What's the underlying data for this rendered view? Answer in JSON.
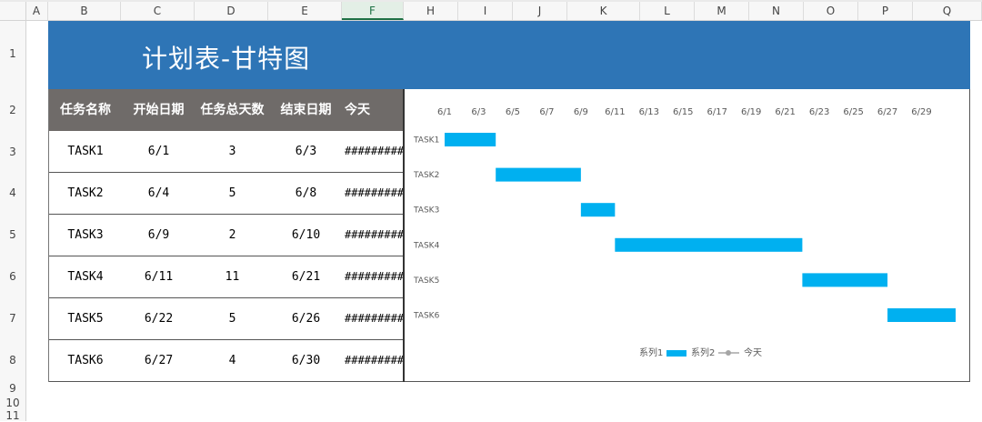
{
  "sheet": {
    "columns": [
      "A",
      "B",
      "C",
      "D",
      "E",
      "F",
      "H",
      "I",
      "J",
      "K",
      "L",
      "M",
      "N",
      "O",
      "P",
      "Q"
    ],
    "selected_column": "F",
    "rows": [
      "1",
      "2",
      "3",
      "4",
      "5",
      "6",
      "7",
      "8",
      "9",
      "10",
      "11"
    ]
  },
  "banner": {
    "title": "计划表-甘特图"
  },
  "table": {
    "headers": [
      "任务名称",
      "开始日期",
      "任务总天数",
      "结束日期",
      "今天"
    ],
    "rows": [
      [
        "TASK1",
        "6/1",
        "3",
        "6/3",
        "#########"
      ],
      [
        "TASK2",
        "6/4",
        "5",
        "6/8",
        "#########"
      ],
      [
        "TASK3",
        "6/9",
        "2",
        "6/10",
        "#########"
      ],
      [
        "TASK4",
        "6/11",
        "11",
        "6/21",
        "#########"
      ],
      [
        "TASK5",
        "6/22",
        "5",
        "6/26",
        "#########"
      ],
      [
        "TASK6",
        "6/27",
        "4",
        "6/30",
        "#########"
      ]
    ]
  },
  "colors": {
    "banner": "#2e75b6",
    "header": "#6f6b69",
    "bar": "#00b0f0",
    "today": "#a5a5a5"
  },
  "chart_data": {
    "type": "bar",
    "orientation": "horizontal-stacked-gantt",
    "categories": [
      "TASK1",
      "TASK2",
      "TASK3",
      "TASK4",
      "TASK5",
      "TASK6"
    ],
    "x_ticks": [
      "6/1",
      "6/3",
      "6/5",
      "6/7",
      "6/9",
      "6/11",
      "6/13",
      "6/15",
      "6/17",
      "6/19",
      "6/21",
      "6/23",
      "6/25",
      "6/27",
      "6/29"
    ],
    "xlim_day": [
      1,
      31
    ],
    "series": [
      {
        "name": "系列1",
        "values": [
          1,
          4,
          9,
          11,
          22,
          27
        ],
        "visible": false
      },
      {
        "name": "系列2",
        "values": [
          3,
          5,
          2,
          11,
          5,
          4
        ]
      }
    ],
    "legend": [
      "系列1",
      "系列2",
      "今天"
    ],
    "legend_position": "bottom"
  }
}
